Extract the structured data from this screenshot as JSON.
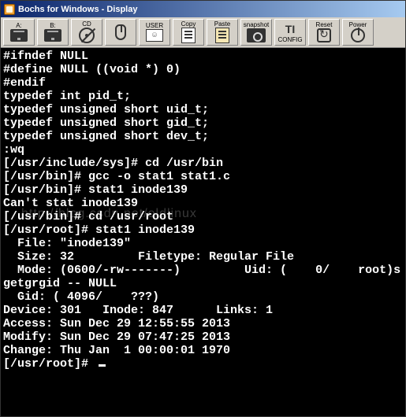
{
  "window": {
    "title": "Bochs for Windows - Display"
  },
  "toolbar": {
    "drive_a": "A:",
    "drive_b": "B:",
    "drive_cd": "CD",
    "mouse": "",
    "user": "USER",
    "copy": "Copy",
    "paste": "Paste",
    "snapshot": "snapshot",
    "config": "CONFIG",
    "reset": "Reset",
    "power": "Power"
  },
  "terminal": {
    "lines": [
      "#ifndef NULL",
      "#define NULL ((void *) 0)",
      "#endif",
      "",
      "typedef int pid_t;",
      "typedef unsigned short uid_t;",
      "typedef unsigned short gid_t;",
      "typedef unsigned short dev_t;",
      ":wq",
      "[/usr/include/sys]# cd /usr/bin",
      "[/usr/bin]# gcc -o stat1 stat1.c",
      "[/usr/bin]# stat1 inode139",
      "Can't stat inode139",
      "[/usr/bin]# cd /usr/root",
      "[/usr/root]# stat1 inode139",
      "  File: \"inode139\"",
      "  Size: 32         Filetype: Regular File",
      "  Mode: (0600/-rw-------)         Uid: (    0/    root)s",
      "getgrgid -- NULL",
      "  Gid: ( 4096/    ???)",
      "Device: 301   Inode: 847      Links: 1",
      "Access: Sun Dec 29 12:55:55 2013",
      "Modify: Sun Dec 29 07:47:25 2013",
      "Change: Thu Jan  1 00:00:01 1970",
      "[/usr/root]# "
    ]
  },
  "watermark": "http://blog.csdn.net/oldlinux"
}
